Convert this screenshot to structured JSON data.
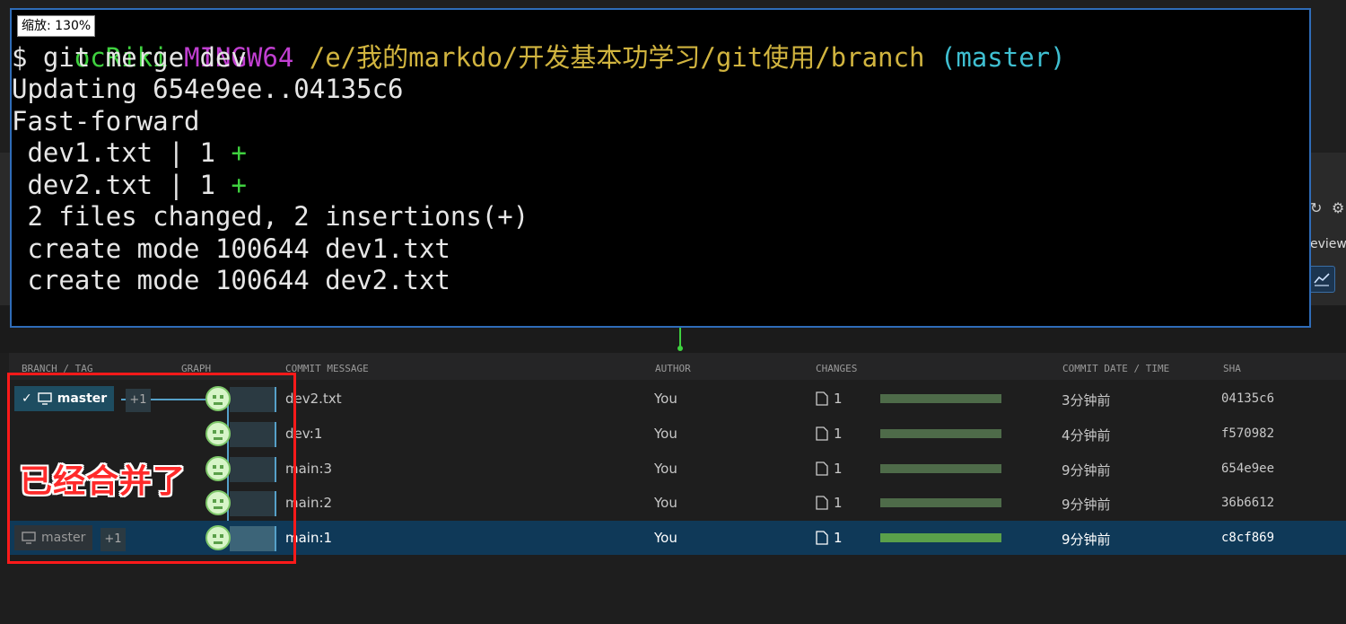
{
  "zoom_badge": "缩放: 130%",
  "terminal": {
    "prompt": {
      "user": "ocRiki",
      "host": "MINGW64",
      "path": "/e/我的markdo/开发基本功学习/git使用/branch",
      "branch": "(master)"
    },
    "command": "$ git merge dev",
    "output": [
      "Updating 654e9ee..04135c6",
      "Fast-forward",
      " dev1.txt | 1 ",
      " dev2.txt | 1 ",
      " 2 files changed, 2 insertions(+)",
      " create mode 100644 dev1.txt",
      " create mode 100644 dev2.txt"
    ],
    "plus_sign": "+"
  },
  "right_panel": {
    "review_label": "eview"
  },
  "graph": {
    "columns": {
      "branch_tag": "BRANCH / TAG",
      "graph": "GRAPH",
      "message": "COMMIT MESSAGE",
      "author": "AUTHOR",
      "changes": "CHANGES",
      "date": "COMMIT DATE / TIME",
      "sha": "SHA"
    },
    "top_branch": {
      "label": "master",
      "extra": "+1"
    },
    "bottom_branch": {
      "label": "master",
      "extra": "+1"
    },
    "rows": [
      {
        "message": "dev2.txt",
        "author": "You",
        "changes": "1",
        "date": "3分钟前",
        "sha": "04135c6"
      },
      {
        "message": "dev:1",
        "author": "You",
        "changes": "1",
        "date": "4分钟前",
        "sha": "f570982"
      },
      {
        "message": "main:3",
        "author": "You",
        "changes": "1",
        "date": "9分钟前",
        "sha": "654e9ee"
      },
      {
        "message": "main:2",
        "author": "You",
        "changes": "1",
        "date": "9分钟前",
        "sha": "36b6612"
      },
      {
        "message": "main:1",
        "author": "You",
        "changes": "1",
        "date": "9分钟前",
        "sha": "c8cf869"
      }
    ]
  },
  "annotation": "已经合并了",
  "colors": {
    "terminal_border": "#2f6cb8",
    "prompt_user": "#3fd13f",
    "prompt_host": "#c13fd1",
    "prompt_path": "#d1b43f",
    "prompt_branch": "#3fbfd1",
    "annotation_red": "#ff2a2a",
    "selected_row": "#0f3958"
  }
}
